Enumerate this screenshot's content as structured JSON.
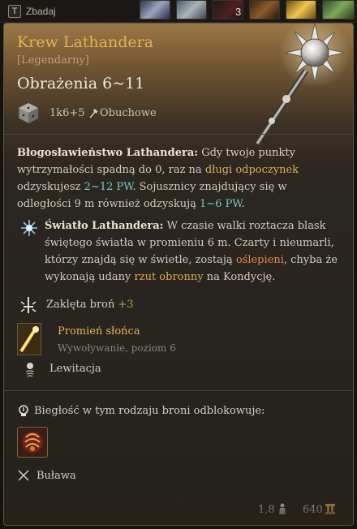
{
  "topbar": {
    "key_label": "T",
    "inspect_label": "Zbadaj",
    "slot_count": "3"
  },
  "item": {
    "name": "Krew Lathandera",
    "rarity": "[Legendarny]",
    "damage_title": "Obrażenia 6~11",
    "damage_dice": "1k6+5",
    "damage_type": "Obuchowe",
    "icon": "morningstar-mace-icon"
  },
  "blessing": {
    "title": "Błogosławieństwo Lathandera:",
    "text_1": "Gdy twoje punkty wytrzymałości spadną do 0, raz na",
    "long_rest": "długi odpoczynek",
    "text_2": "odzyskujesz",
    "heal_self": "2~12 PW",
    "text_3": ". Sojusznicy znajdujący się w odległości 9 m również odzyskują",
    "heal_allies": "1~6 PW",
    "text_4": "."
  },
  "light": {
    "title": "Światło Lathandera:",
    "text_1": "W czasie walki roztacza blask świętego światła w promieniu 6 m. Czarty i nieumarli, którzy znajdą się w świetle, zostają",
    "blinded": "oślepieni",
    "text_2": ", chyba że wykonają udany",
    "save": "rzut obronny",
    "text_3": "na Kondycję."
  },
  "enchant": {
    "label": "Zaklęta broń",
    "bonus": "+3"
  },
  "spell": {
    "title": "Promień słońca",
    "subtitle": "Wywoływanie, poziom 6"
  },
  "levitation": {
    "label": "Lewitacja"
  },
  "proficiency": {
    "label": "Biegłość w tym rodzaju broni odblokowuje:",
    "weapon_type": "Buława"
  },
  "footer": {
    "weight": "1,8",
    "price": "640"
  },
  "colors": {
    "title_gold": "#e3b254",
    "highlight_gold": "#d9ac55",
    "heal_cyan": "#79c6c8",
    "condition_orange": "#e08b4c"
  }
}
